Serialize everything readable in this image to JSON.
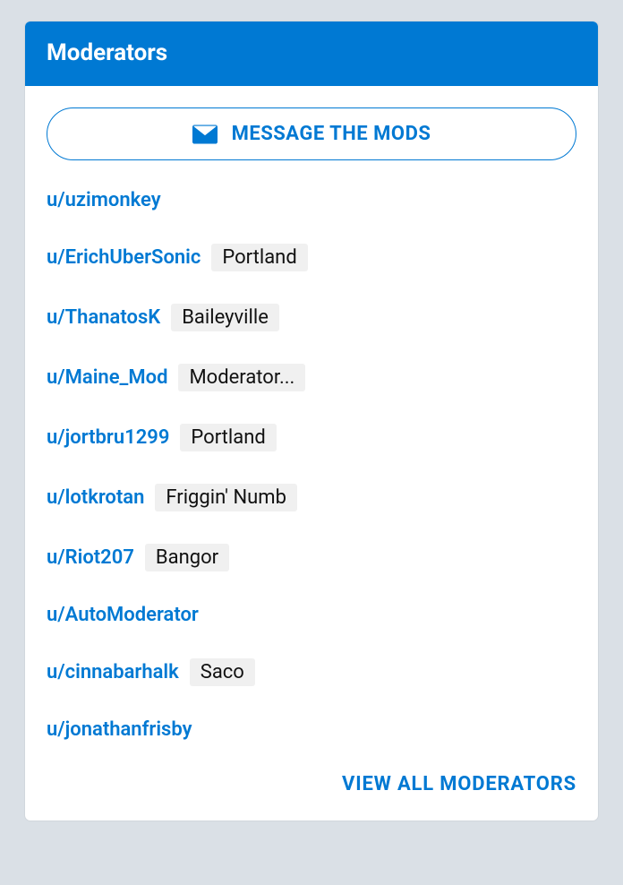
{
  "header": {
    "title": "Moderators"
  },
  "message_button": {
    "label": "MESSAGE THE MODS"
  },
  "moderators": [
    {
      "username": "u/uzimonkey",
      "flair": null
    },
    {
      "username": "u/ErichUberSonic",
      "flair": "Portland"
    },
    {
      "username": "u/ThanatosK",
      "flair": "Baileyville"
    },
    {
      "username": "u/Maine_Mod",
      "flair": "Moderator..."
    },
    {
      "username": "u/jortbru1299",
      "flair": "Portland"
    },
    {
      "username": "u/lotkrotan",
      "flair": "Friggin' Numb"
    },
    {
      "username": "u/Riot207",
      "flair": "Bangor"
    },
    {
      "username": "u/AutoModerator",
      "flair": null
    },
    {
      "username": "u/cinnabarhalk",
      "flair": "Saco"
    },
    {
      "username": "u/jonathanfrisby",
      "flair": null
    }
  ],
  "view_all": {
    "label": "VIEW ALL MODERATORS"
  }
}
